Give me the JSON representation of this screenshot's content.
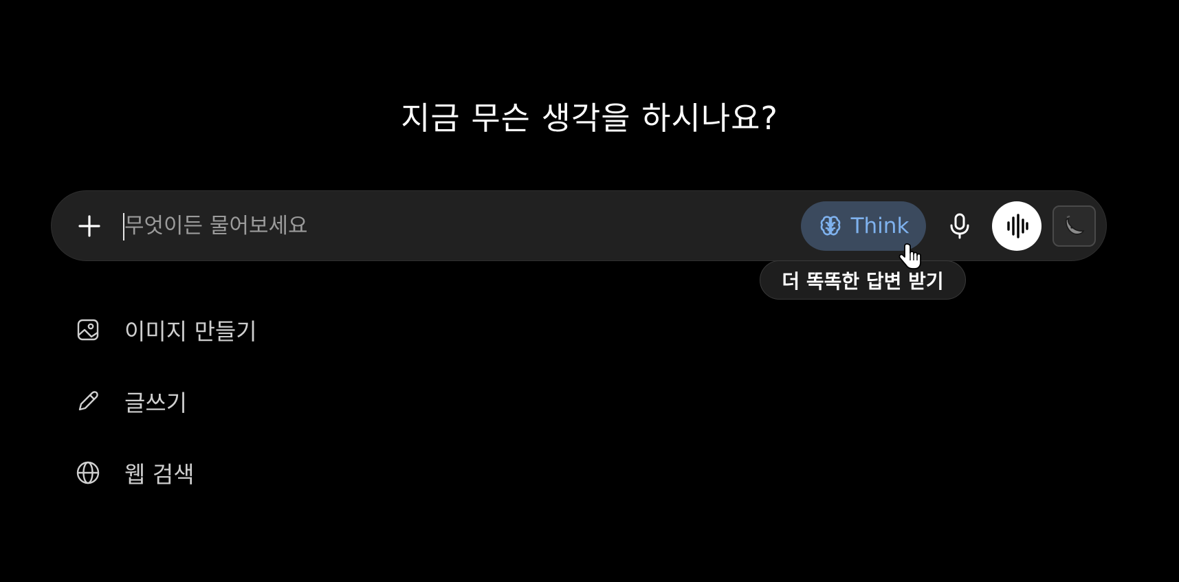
{
  "headline": "지금 무슨 생각을 하시나요?",
  "composer": {
    "placeholder": "무엇이든 물어보세요",
    "value": "",
    "think_label": "Think",
    "tooltip": "더 똑똑한 답변 받기"
  },
  "icons": {
    "plus": "plus-icon",
    "think": "brain-icon",
    "mic": "microphone-icon",
    "voice": "voice-waveform-icon",
    "extension": "banana-extension-icon",
    "cursor": "hand-pointer-cursor"
  },
  "actions": [
    {
      "label": "이미지 만들기",
      "icon": "image-icon"
    },
    {
      "label": "글쓰기",
      "icon": "pencil-icon"
    },
    {
      "label": "웹 검색",
      "icon": "globe-icon"
    }
  ],
  "colors": {
    "background": "#000000",
    "composer_bg": "#212121",
    "think_bg": "#3b4a5e",
    "think_accent": "#7fb2ee",
    "placeholder": "#9b9b9b"
  }
}
